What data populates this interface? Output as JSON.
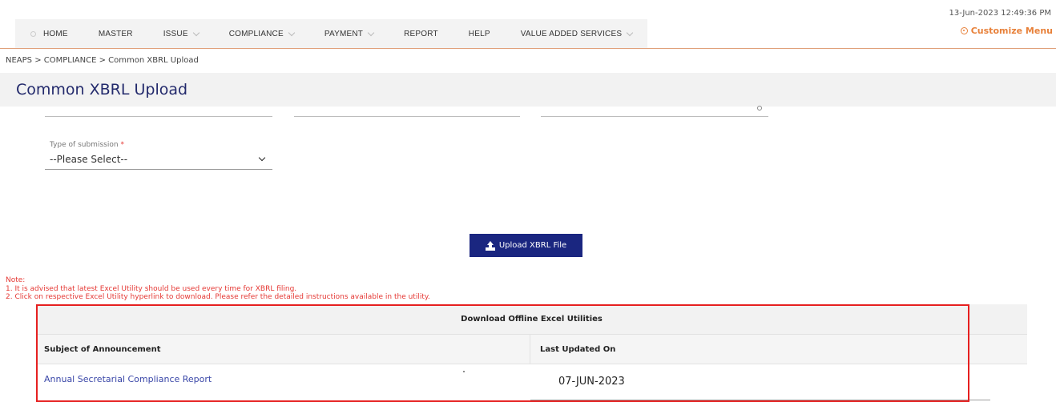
{
  "header": {
    "datetime": "13-Jun-2023 12:49:36 PM",
    "customize_label": "Customize Menu"
  },
  "nav": {
    "items": [
      {
        "label": "HOME"
      },
      {
        "label": "MASTER"
      },
      {
        "label": "ISSUE"
      },
      {
        "label": "COMPLIANCE"
      },
      {
        "label": "PAYMENT"
      },
      {
        "label": "REPORT"
      },
      {
        "label": "HELP"
      },
      {
        "label": "VALUE ADDED SERVICES"
      }
    ]
  },
  "breadcrumb": "NEAPS > COMPLIANCE > Common XBRL Upload",
  "page_title": "Common XBRL Upload",
  "form": {
    "submission_type_label": "Type of submission",
    "required_mark": "*",
    "submission_type_value": "--Please Select--"
  },
  "upload_button_label": "Upload XBRL File",
  "notes": {
    "heading": "Note:",
    "line1": "1. It is advised that latest Excel Utility should be used every time for XBRL filing.",
    "line2": "2. Click on respective Excel Utility hyperlink to download. Please refer the detailed instructions available in the utility."
  },
  "table": {
    "title": "Download Offline Excel Utilities",
    "col_subject": "Subject of Announcement",
    "col_updated": "Last Updated On",
    "rows": [
      {
        "subject": "Annual Secretarial Compliance Report",
        "updated": "07-JUN-2023"
      }
    ]
  },
  "colors": {
    "accent": "#e8813a",
    "title": "#232a6c",
    "button": "#1a2680",
    "note": "#e53935",
    "highlight": "#e62020",
    "link": "#3a47a8"
  }
}
